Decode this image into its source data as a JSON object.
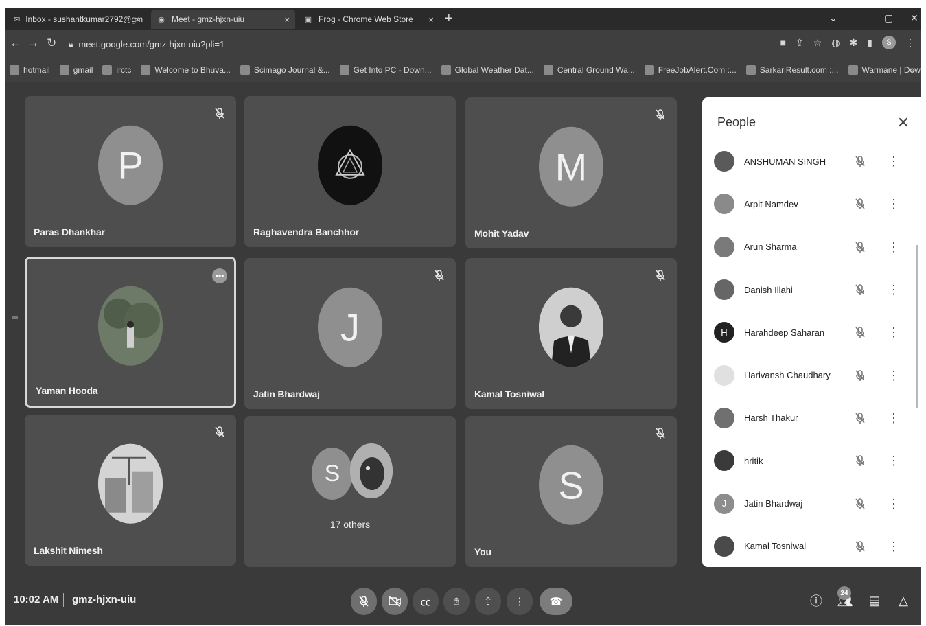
{
  "browser": {
    "tabs": [
      {
        "title": "Inbox - sushantkumar2792@gm",
        "icon": "gmail-icon",
        "close": "×"
      },
      {
        "title": "Meet - gmz-hjxn-uiu",
        "icon": "meet-icon",
        "close": "×"
      },
      {
        "title": "Frog - Chrome Web Store",
        "icon": "webstore-icon",
        "close": "×"
      }
    ],
    "new_tab": "+",
    "url": "meet.google.com/gmz-hjxn-uiu?pli=1",
    "profile_initial": "S",
    "bookmarks": [
      "hotmail",
      "gmail",
      "irctc",
      "Welcome to Bhuva...",
      "Scimago Journal &...",
      "Get Into PC - Down...",
      "Global Weather Dat...",
      "Central Ground Wa...",
      "FreeJobAlert.Com :...",
      "SarkariResult.com :...",
      "Warmane | Download"
    ],
    "bookmarks_more": "»"
  },
  "tiles": [
    {
      "name": "Paras Dhankhar",
      "initial": "P",
      "muted": true
    },
    {
      "name": "Raghavendra Banchhor",
      "initial": "",
      "muted": false
    },
    {
      "name": "Mohit Yadav",
      "initial": "M",
      "muted": true
    },
    {
      "name": "Yaman Hooda",
      "initial": "",
      "muted": false
    },
    {
      "name": "Jatin Bhardwaj",
      "initial": "J",
      "muted": true
    },
    {
      "name": "Kamal Tosniwal",
      "initial": "",
      "muted": true
    },
    {
      "name": "Lakshit Nimesh",
      "initial": "",
      "muted": true
    },
    {
      "name": "17 others",
      "initial": "S",
      "muted": false
    },
    {
      "name": "You",
      "initial": "S",
      "muted": true
    }
  ],
  "people_panel": {
    "title": "People",
    "close": "✕",
    "participants": [
      {
        "name": "ANSHUMAN SINGH",
        "initial": ""
      },
      {
        "name": "Arpit Namdev",
        "initial": ""
      },
      {
        "name": "Arun Sharma",
        "initial": ""
      },
      {
        "name": "Danish Illahi",
        "initial": ""
      },
      {
        "name": "Harahdeep Saharan",
        "initial": "H"
      },
      {
        "name": "Harivansh Chaudhary",
        "initial": ""
      },
      {
        "name": "Harsh Thakur",
        "initial": ""
      },
      {
        "name": "hritik",
        "initial": ""
      },
      {
        "name": "Jatin Bhardwaj",
        "initial": "J"
      },
      {
        "name": "Kamal Tosniwal",
        "initial": ""
      }
    ]
  },
  "bottom_bar": {
    "time": "10:02 AM",
    "meeting_code": "gmz-hjxn-uiu",
    "participant_count": "24"
  }
}
